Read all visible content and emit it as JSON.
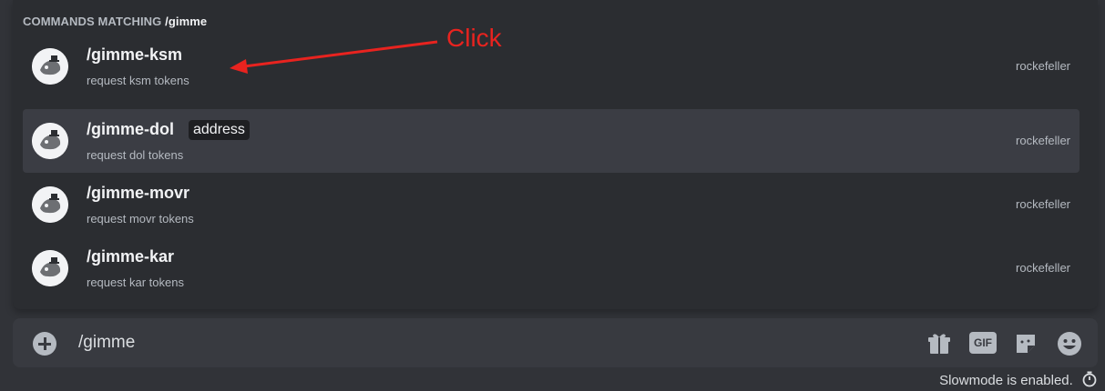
{
  "popup": {
    "header_label": "COMMANDS MATCHING",
    "header_query": "/gimme",
    "commands": [
      {
        "name": "/gimme-ksm",
        "option": "",
        "description": "request ksm tokens",
        "app": "rockefeller",
        "selected": false
      },
      {
        "name": "/gimme-dol",
        "option": "address",
        "description": "request dol tokens",
        "app": "rockefeller",
        "selected": true
      },
      {
        "name": "/gimme-movr",
        "option": "",
        "description": "request movr tokens",
        "app": "rockefeller",
        "selected": false
      },
      {
        "name": "/gimme-kar",
        "option": "",
        "description": "request kar tokens",
        "app": "rockefeller",
        "selected": false
      }
    ]
  },
  "annotation": {
    "text": "Click",
    "color": "#e8231f"
  },
  "chatbar": {
    "input_value": "/gimme",
    "buttons": {
      "gif_label": "GIF"
    }
  },
  "footer": {
    "slowmode_text": "Slowmode is enabled."
  },
  "icons": [
    "add-icon",
    "gift-icon",
    "gif-icon",
    "sticker-icon",
    "emoji-icon",
    "timer-icon"
  ],
  "colors": {
    "background": "#313338",
    "popup": "#2b2d31",
    "selected_row": "#3b3d44"
  }
}
